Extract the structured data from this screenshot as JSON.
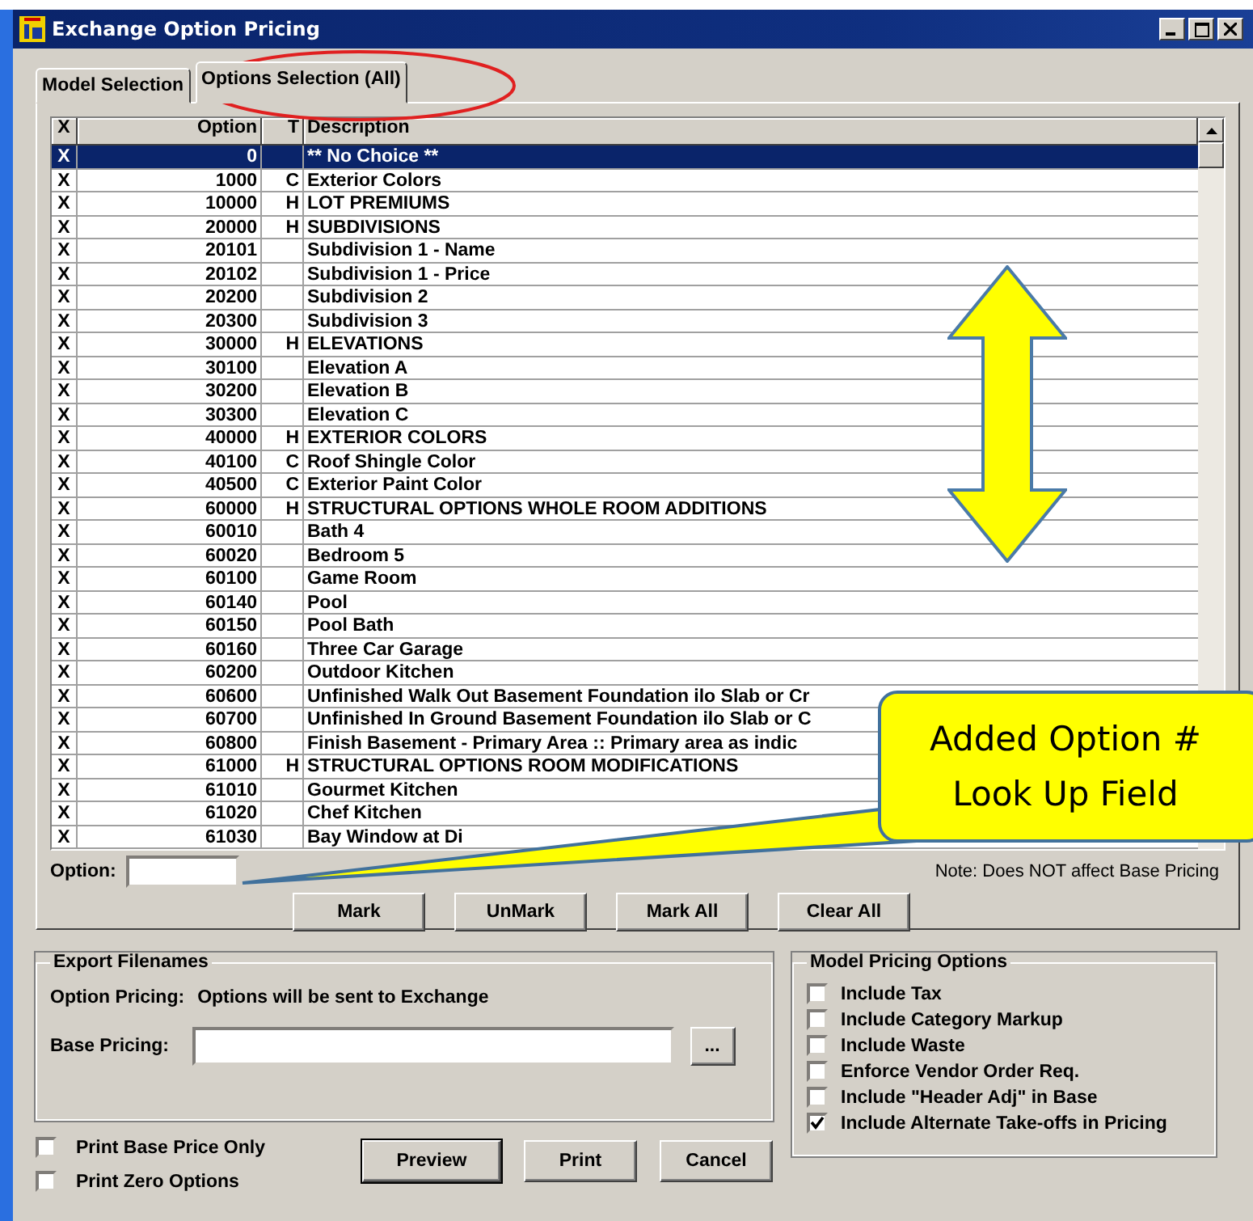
{
  "window": {
    "title": "Exchange Option Pricing"
  },
  "tabs": [
    {
      "label": "Model Selection",
      "selected": false
    },
    {
      "label": "Options Selection (All)",
      "selected": true
    }
  ],
  "table": {
    "columns": [
      "X",
      "Option",
      "T",
      "Description"
    ],
    "rows": [
      {
        "mark": "X",
        "option": "0",
        "type": "",
        "description": "** No Choice **",
        "selected": true
      },
      {
        "mark": "X",
        "option": "1000",
        "type": "C",
        "description": "Exterior Colors",
        "selected": false
      },
      {
        "mark": "X",
        "option": "10000",
        "type": "H",
        "description": "LOT PREMIUMS",
        "selected": false
      },
      {
        "mark": "X",
        "option": "20000",
        "type": "H",
        "description": "SUBDIVISIONS",
        "selected": false
      },
      {
        "mark": "X",
        "option": "20101",
        "type": "",
        "description": "Subdivision 1 - Name",
        "selected": false
      },
      {
        "mark": "X",
        "option": "20102",
        "type": "",
        "description": "Subdivision 1 - Price",
        "selected": false
      },
      {
        "mark": "X",
        "option": "20200",
        "type": "",
        "description": "Subdivision 2",
        "selected": false
      },
      {
        "mark": "X",
        "option": "20300",
        "type": "",
        "description": "Subdivision 3",
        "selected": false
      },
      {
        "mark": "X",
        "option": "30000",
        "type": "H",
        "description": "ELEVATIONS",
        "selected": false
      },
      {
        "mark": "X",
        "option": "30100",
        "type": "",
        "description": "Elevation A",
        "selected": false
      },
      {
        "mark": "X",
        "option": "30200",
        "type": "",
        "description": "Elevation B",
        "selected": false
      },
      {
        "mark": "X",
        "option": "30300",
        "type": "",
        "description": "Elevation C",
        "selected": false
      },
      {
        "mark": "X",
        "option": "40000",
        "type": "H",
        "description": "EXTERIOR COLORS",
        "selected": false
      },
      {
        "mark": "X",
        "option": "40100",
        "type": "C",
        "description": "Roof Shingle Color",
        "selected": false
      },
      {
        "mark": "X",
        "option": "40500",
        "type": "C",
        "description": "Exterior Paint Color",
        "selected": false
      },
      {
        "mark": "X",
        "option": "60000",
        "type": "H",
        "description": "STRUCTURAL OPTIONS WHOLE ROOM ADDITIONS",
        "selected": false
      },
      {
        "mark": "X",
        "option": "60010",
        "type": "",
        "description": "Bath 4",
        "selected": false
      },
      {
        "mark": "X",
        "option": "60020",
        "type": "",
        "description": "Bedroom 5",
        "selected": false
      },
      {
        "mark": "X",
        "option": "60100",
        "type": "",
        "description": "Game Room",
        "selected": false
      },
      {
        "mark": "X",
        "option": "60140",
        "type": "",
        "description": "Pool",
        "selected": false
      },
      {
        "mark": "X",
        "option": "60150",
        "type": "",
        "description": "Pool Bath",
        "selected": false
      },
      {
        "mark": "X",
        "option": "60160",
        "type": "",
        "description": "Three Car Garage",
        "selected": false
      },
      {
        "mark": "X",
        "option": "60200",
        "type": "",
        "description": "Outdoor Kitchen",
        "selected": false
      },
      {
        "mark": "X",
        "option": "60600",
        "type": "",
        "description": "Unfinished Walk Out Basement Foundation ilo Slab or Cr",
        "selected": false
      },
      {
        "mark": "X",
        "option": "60700",
        "type": "",
        "description": "Unfinished In Ground Basement Foundation ilo Slab or C",
        "selected": false
      },
      {
        "mark": "X",
        "option": "60800",
        "type": "",
        "description": "Finish Basement - Primary Area ::  Primary area  as indic",
        "selected": false
      },
      {
        "mark": "X",
        "option": "61000",
        "type": "H",
        "description": "STRUCTURAL OPTIONS ROOM MODIFICATIONS",
        "selected": false
      },
      {
        "mark": "X",
        "option": "61010",
        "type": "",
        "description": "Gourmet Kitchen",
        "selected": false
      },
      {
        "mark": "X",
        "option": "61020",
        "type": "",
        "description": "Chef Kitchen",
        "selected": false
      },
      {
        "mark": "X",
        "option": "61030",
        "type": "",
        "description": "Bay Window at Di",
        "selected": false
      }
    ]
  },
  "option_lookup": {
    "label": "Option:",
    "note": "Note: Does NOT affect Base Pricing"
  },
  "mark_buttons": [
    "Mark",
    "UnMark",
    "Mark All",
    "Clear All"
  ],
  "export_filenames": {
    "title": "Export Filenames",
    "option_pricing_label": "Option Pricing:",
    "option_pricing_value": "Options will be sent to Exchange",
    "base_pricing_label": "Base Pricing:",
    "browse_button": "..."
  },
  "print_options": [
    {
      "label": "Print Base Price Only",
      "checked": false
    },
    {
      "label": "Print Zero Options",
      "checked": false
    }
  ],
  "action_buttons": [
    {
      "label": "Preview",
      "default": true
    },
    {
      "label": "Print",
      "default": false
    },
    {
      "label": "Cancel",
      "default": false
    }
  ],
  "model_pricing_options": {
    "title": "Model Pricing Options",
    "options": [
      {
        "label": "Include Tax",
        "checked": false
      },
      {
        "label": "Include Category Markup",
        "checked": false
      },
      {
        "label": "Include Waste",
        "checked": false
      },
      {
        "label": "Enforce Vendor Order Req.",
        "checked": false
      },
      {
        "label": "Include \"Header Adj\" in Base",
        "checked": false
      },
      {
        "label": "Include Alternate Take-offs in Pricing",
        "checked": true
      }
    ]
  },
  "callout": {
    "lines": [
      "Added Option #",
      "Look Up Field"
    ]
  }
}
